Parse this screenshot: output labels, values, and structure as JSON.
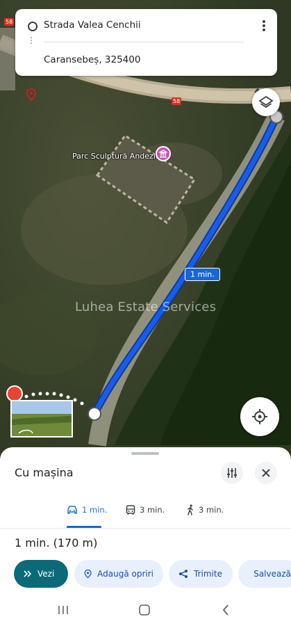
{
  "route": {
    "origin": "Strada Valea Cenchii",
    "destination": "Caransebeș, 325400"
  },
  "map": {
    "poi_label": "Parc Sculptură Andezit",
    "road_number_a": "58",
    "road_number_b": "58",
    "route_duration": "1 min.",
    "watermark": "Luhea Estate Services",
    "route_color": "#1a5ce6"
  },
  "sheet": {
    "title": "Cu mașina",
    "modes": [
      {
        "icon": "car-icon",
        "label": "1 min.",
        "active": true
      },
      {
        "icon": "transit-icon",
        "label": "3 min.",
        "active": false
      },
      {
        "icon": "walk-icon",
        "label": "3 min.",
        "active": false
      }
    ],
    "summary": "1 min. (170 m)",
    "actions": [
      {
        "icon": "navigate-icon",
        "label": "Vezi"
      },
      {
        "icon": "add-stop-icon",
        "label": "Adaugă opriri"
      },
      {
        "icon": "share-icon",
        "label": "Trimite"
      },
      {
        "icon": "bookmark-icon",
        "label": "Salvează"
      }
    ]
  },
  "colors": {
    "accent": "#1a73e8",
    "primary_chip": "#0b6a78",
    "chip_bg": "#e8f0fe"
  }
}
